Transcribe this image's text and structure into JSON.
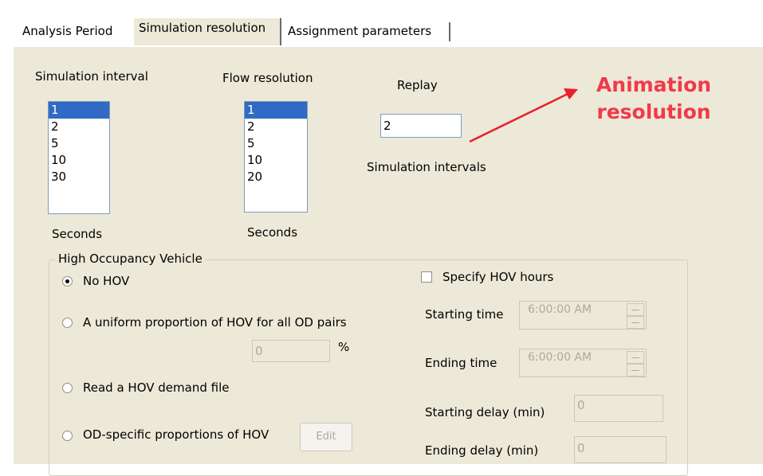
{
  "tabs": [
    {
      "label": "Analysis Period",
      "selected": false
    },
    {
      "label": "Simulation resolution",
      "selected": true
    },
    {
      "label": "Assignment parameters",
      "selected": false
    }
  ],
  "simulation_interval": {
    "label": "Simulation interval",
    "options": [
      "1",
      "2",
      "5",
      "10",
      "30"
    ],
    "selected": "1",
    "unit": "Seconds"
  },
  "flow_resolution": {
    "label": "Flow resolution",
    "options": [
      "1",
      "2",
      "5",
      "10",
      "20"
    ],
    "selected": "1",
    "unit": "Seconds"
  },
  "replay": {
    "label": "Replay",
    "value": "2",
    "unit": "Simulation intervals"
  },
  "annotation": {
    "line1": "Animation",
    "line2": "resolution",
    "color": "#f03a4a"
  },
  "hov": {
    "group_label": "High Occupancy Vehicle",
    "options": [
      {
        "label": "No HOV",
        "selected": true
      },
      {
        "label": "A uniform proportion of HOV for all OD pairs",
        "selected": false
      },
      {
        "label": "Read a HOV demand file",
        "selected": false
      },
      {
        "label": "OD-specific proportions of HOV",
        "selected": false
      }
    ],
    "uniform_value": "0",
    "percent_symbol": "%",
    "edit_button": "Edit",
    "specify_hours": {
      "label": "Specify HOV hours",
      "checked": false
    },
    "starting_time": {
      "label": "Starting time",
      "value": "6:00:00 AM"
    },
    "ending_time": {
      "label": "Ending time",
      "value": "6:00:00 AM"
    },
    "starting_delay": {
      "label": "Starting delay (min)",
      "value": "0"
    },
    "ending_delay": {
      "label": "Ending delay (min)",
      "value": "0"
    }
  }
}
